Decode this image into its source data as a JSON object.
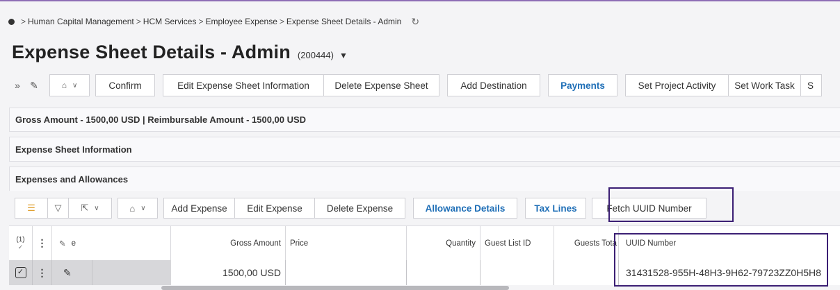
{
  "breadcrumb": {
    "items": [
      "Human Capital Management",
      "HCM Services",
      "Employee Expense",
      "Expense Sheet Details - Admin"
    ],
    "separator": ">"
  },
  "page": {
    "title": "Expense Sheet Details - Admin",
    "record_id": "(200444)"
  },
  "toolbar": {
    "buttons": [
      "Confirm",
      "Edit Expense Sheet Information",
      "Delete Expense Sheet",
      "Add Destination",
      "Payments",
      "Set Project Activity",
      "Set Work Task",
      "S"
    ]
  },
  "panels": {
    "amounts": "Gross Amount - 1500,00 USD | Reimbursable Amount - 1500,00 USD",
    "sheet_info": "Expense Sheet Information",
    "expenses": "Expenses and Allowances"
  },
  "expenses_toolbar": {
    "buttons": [
      "Add Expense",
      "Edit Expense",
      "Delete Expense",
      "Allowance Details",
      "Tax Lines",
      "Fetch UUID Number"
    ]
  },
  "grid": {
    "selected_count": "(1)",
    "columns": [
      "e",
      "Gross Amount",
      "Price",
      "Quantity",
      "Guest List ID",
      "Guests Tota",
      "UUID Number"
    ],
    "rows": [
      {
        "gross_amount": "1500,00 USD",
        "price": "",
        "quantity": "",
        "guest_list_id": "",
        "guests_total": "",
        "uuid": "31431528-955H-48H3-9H62-79723ZZ0H5H8"
      }
    ]
  },
  "colors": {
    "accent": "#1f6fb7",
    "highlight_border": "#3b1f74",
    "top_line": "#8e6db5"
  }
}
